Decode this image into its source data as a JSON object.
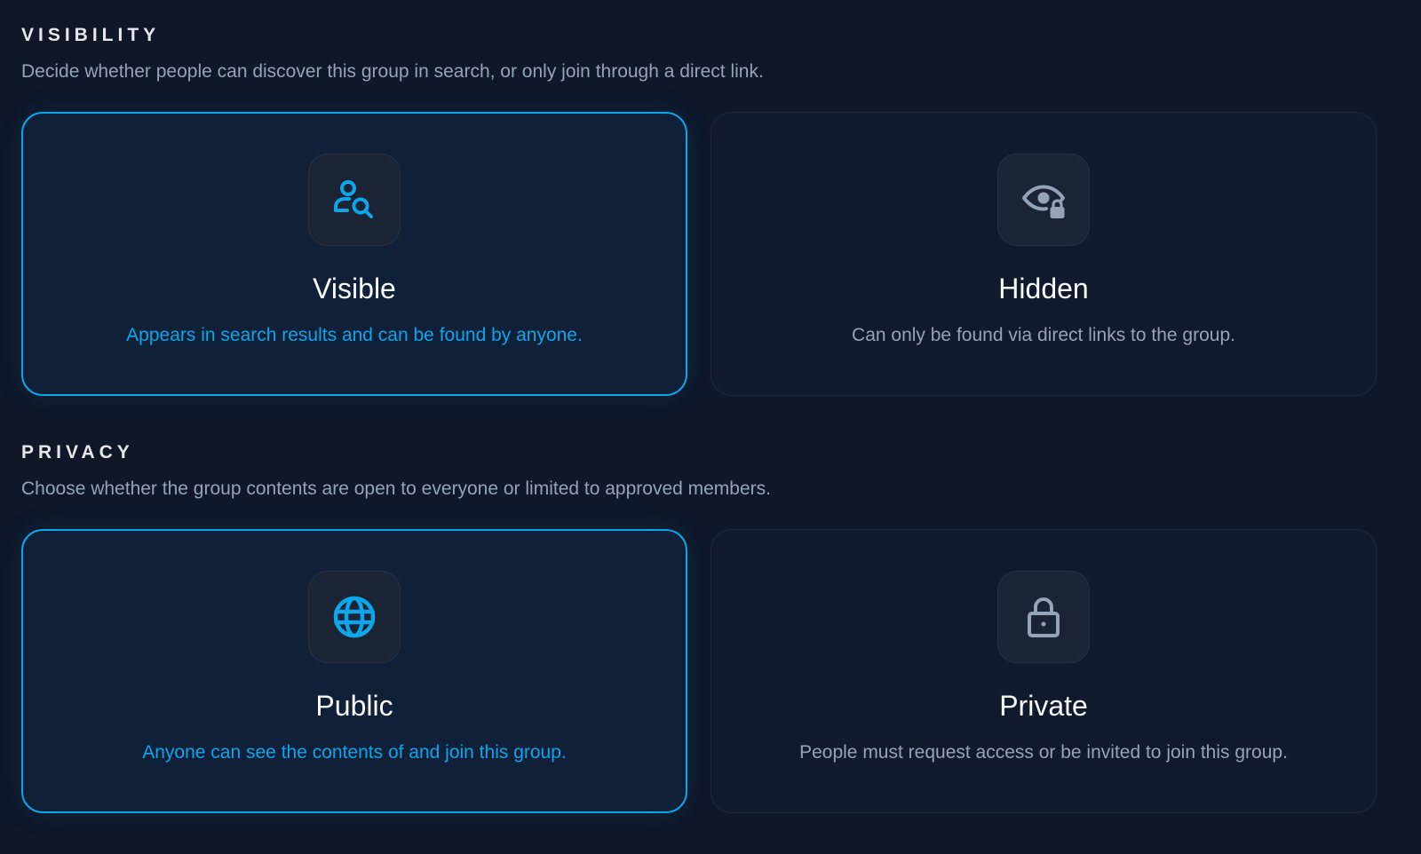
{
  "colors": {
    "background": "#0f1729",
    "accent": "#0ea5e9",
    "muted_text": "#94a3b8",
    "icon_muted": "#94a3b8"
  },
  "visibility": {
    "title": "VISIBILITY",
    "description": "Decide whether people can discover this group in search, or only join through a direct link.",
    "options": [
      {
        "icon": "user-search-icon",
        "label": "Visible",
        "description": "Appears in search results and can be found by anyone.",
        "selected": true
      },
      {
        "icon": "eye-lock-icon",
        "label": "Hidden",
        "description": "Can only be found via direct links to the group.",
        "selected": false
      }
    ]
  },
  "privacy": {
    "title": "PRIVACY",
    "description": "Choose whether the group contents are open to everyone or limited to approved members.",
    "options": [
      {
        "icon": "globe-icon",
        "label": "Public",
        "description": "Anyone can see the contents of and join this group.",
        "selected": true
      },
      {
        "icon": "lock-icon",
        "label": "Private",
        "description": "People must request access or be invited to join this group.",
        "selected": false
      }
    ]
  }
}
